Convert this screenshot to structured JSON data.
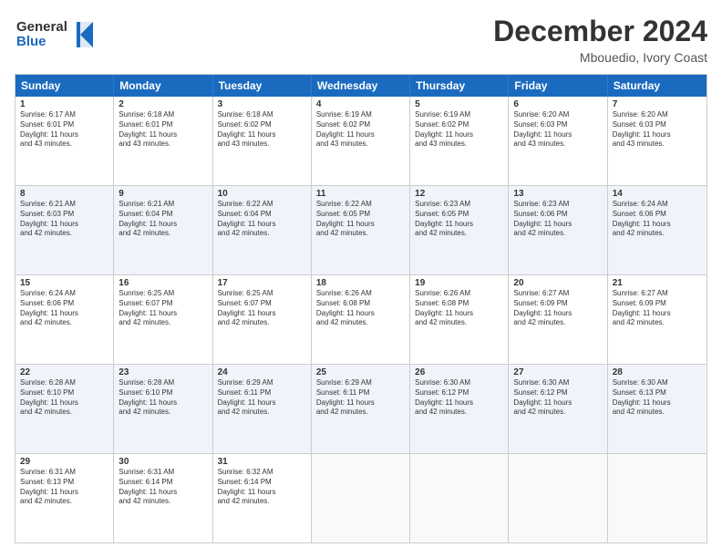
{
  "logo": {
    "line1": "General",
    "line2": "Blue"
  },
  "header": {
    "title": "December 2024",
    "location": "Mbouedio, Ivory Coast"
  },
  "weekdays": [
    "Sunday",
    "Monday",
    "Tuesday",
    "Wednesday",
    "Thursday",
    "Friday",
    "Saturday"
  ],
  "rows": [
    [
      {
        "day": "1",
        "lines": [
          "Sunrise: 6:17 AM",
          "Sunset: 6:01 PM",
          "Daylight: 11 hours",
          "and 43 minutes."
        ]
      },
      {
        "day": "2",
        "lines": [
          "Sunrise: 6:18 AM",
          "Sunset: 6:01 PM",
          "Daylight: 11 hours",
          "and 43 minutes."
        ]
      },
      {
        "day": "3",
        "lines": [
          "Sunrise: 6:18 AM",
          "Sunset: 6:02 PM",
          "Daylight: 11 hours",
          "and 43 minutes."
        ]
      },
      {
        "day": "4",
        "lines": [
          "Sunrise: 6:19 AM",
          "Sunset: 6:02 PM",
          "Daylight: 11 hours",
          "and 43 minutes."
        ]
      },
      {
        "day": "5",
        "lines": [
          "Sunrise: 6:19 AM",
          "Sunset: 6:02 PM",
          "Daylight: 11 hours",
          "and 43 minutes."
        ]
      },
      {
        "day": "6",
        "lines": [
          "Sunrise: 6:20 AM",
          "Sunset: 6:03 PM",
          "Daylight: 11 hours",
          "and 43 minutes."
        ]
      },
      {
        "day": "7",
        "lines": [
          "Sunrise: 6:20 AM",
          "Sunset: 6:03 PM",
          "Daylight: 11 hours",
          "and 43 minutes."
        ]
      }
    ],
    [
      {
        "day": "8",
        "lines": [
          "Sunrise: 6:21 AM",
          "Sunset: 6:03 PM",
          "Daylight: 11 hours",
          "and 42 minutes."
        ]
      },
      {
        "day": "9",
        "lines": [
          "Sunrise: 6:21 AM",
          "Sunset: 6:04 PM",
          "Daylight: 11 hours",
          "and 42 minutes."
        ]
      },
      {
        "day": "10",
        "lines": [
          "Sunrise: 6:22 AM",
          "Sunset: 6:04 PM",
          "Daylight: 11 hours",
          "and 42 minutes."
        ]
      },
      {
        "day": "11",
        "lines": [
          "Sunrise: 6:22 AM",
          "Sunset: 6:05 PM",
          "Daylight: 11 hours",
          "and 42 minutes."
        ]
      },
      {
        "day": "12",
        "lines": [
          "Sunrise: 6:23 AM",
          "Sunset: 6:05 PM",
          "Daylight: 11 hours",
          "and 42 minutes."
        ]
      },
      {
        "day": "13",
        "lines": [
          "Sunrise: 6:23 AM",
          "Sunset: 6:06 PM",
          "Daylight: 11 hours",
          "and 42 minutes."
        ]
      },
      {
        "day": "14",
        "lines": [
          "Sunrise: 6:24 AM",
          "Sunset: 6:06 PM",
          "Daylight: 11 hours",
          "and 42 minutes."
        ]
      }
    ],
    [
      {
        "day": "15",
        "lines": [
          "Sunrise: 6:24 AM",
          "Sunset: 6:06 PM",
          "Daylight: 11 hours",
          "and 42 minutes."
        ]
      },
      {
        "day": "16",
        "lines": [
          "Sunrise: 6:25 AM",
          "Sunset: 6:07 PM",
          "Daylight: 11 hours",
          "and 42 minutes."
        ]
      },
      {
        "day": "17",
        "lines": [
          "Sunrise: 6:25 AM",
          "Sunset: 6:07 PM",
          "Daylight: 11 hours",
          "and 42 minutes."
        ]
      },
      {
        "day": "18",
        "lines": [
          "Sunrise: 6:26 AM",
          "Sunset: 6:08 PM",
          "Daylight: 11 hours",
          "and 42 minutes."
        ]
      },
      {
        "day": "19",
        "lines": [
          "Sunrise: 6:26 AM",
          "Sunset: 6:08 PM",
          "Daylight: 11 hours",
          "and 42 minutes."
        ]
      },
      {
        "day": "20",
        "lines": [
          "Sunrise: 6:27 AM",
          "Sunset: 6:09 PM",
          "Daylight: 11 hours",
          "and 42 minutes."
        ]
      },
      {
        "day": "21",
        "lines": [
          "Sunrise: 6:27 AM",
          "Sunset: 6:09 PM",
          "Daylight: 11 hours",
          "and 42 minutes."
        ]
      }
    ],
    [
      {
        "day": "22",
        "lines": [
          "Sunrise: 6:28 AM",
          "Sunset: 6:10 PM",
          "Daylight: 11 hours",
          "and 42 minutes."
        ]
      },
      {
        "day": "23",
        "lines": [
          "Sunrise: 6:28 AM",
          "Sunset: 6:10 PM",
          "Daylight: 11 hours",
          "and 42 minutes."
        ]
      },
      {
        "day": "24",
        "lines": [
          "Sunrise: 6:29 AM",
          "Sunset: 6:11 PM",
          "Daylight: 11 hours",
          "and 42 minutes."
        ]
      },
      {
        "day": "25",
        "lines": [
          "Sunrise: 6:29 AM",
          "Sunset: 6:11 PM",
          "Daylight: 11 hours",
          "and 42 minutes."
        ]
      },
      {
        "day": "26",
        "lines": [
          "Sunrise: 6:30 AM",
          "Sunset: 6:12 PM",
          "Daylight: 11 hours",
          "and 42 minutes."
        ]
      },
      {
        "day": "27",
        "lines": [
          "Sunrise: 6:30 AM",
          "Sunset: 6:12 PM",
          "Daylight: 11 hours",
          "and 42 minutes."
        ]
      },
      {
        "day": "28",
        "lines": [
          "Sunrise: 6:30 AM",
          "Sunset: 6:13 PM",
          "Daylight: 11 hours",
          "and 42 minutes."
        ]
      }
    ],
    [
      {
        "day": "29",
        "lines": [
          "Sunrise: 6:31 AM",
          "Sunset: 6:13 PM",
          "Daylight: 11 hours",
          "and 42 minutes."
        ]
      },
      {
        "day": "30",
        "lines": [
          "Sunrise: 6:31 AM",
          "Sunset: 6:14 PM",
          "Daylight: 11 hours",
          "and 42 minutes."
        ]
      },
      {
        "day": "31",
        "lines": [
          "Sunrise: 6:32 AM",
          "Sunset: 6:14 PM",
          "Daylight: 11 hours",
          "and 42 minutes."
        ]
      },
      null,
      null,
      null,
      null
    ]
  ]
}
